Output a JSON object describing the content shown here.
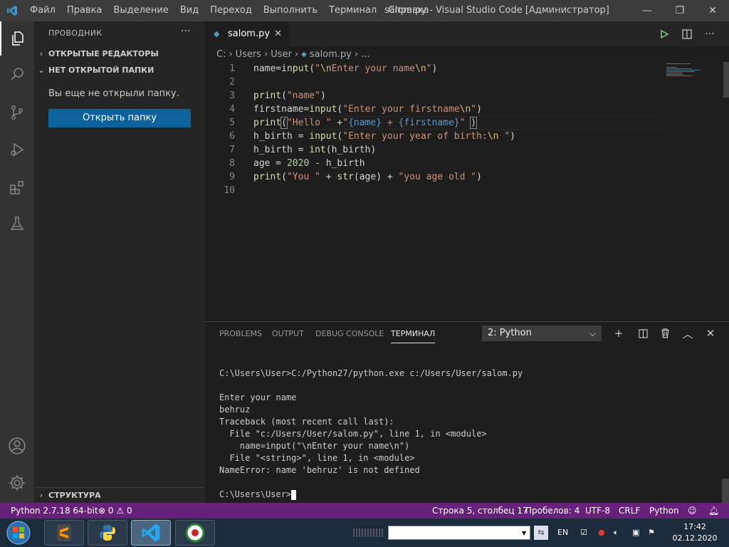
{
  "titlebar": {
    "menu": [
      "Файл",
      "Правка",
      "Выделение",
      "Вид",
      "Переход",
      "Выполнить",
      "Терминал",
      "Справка"
    ],
    "window_title": "salom.py - Visual Studio Code [Администратор]",
    "minimize": "—",
    "maximize": "❐",
    "close": "✕"
  },
  "sidebar": {
    "title": "ПРОВОДНИК",
    "more": "···",
    "sections": {
      "open_editors": "ОТКРЫТЫЕ РЕДАКТОРЫ",
      "no_folder": "НЕТ ОТКРЫТОЙ ПАПКИ",
      "structure": "СТРУКТУРА"
    },
    "no_folder_message": "Вы еще не открыли папку.",
    "open_folder_button": "Открыть папку"
  },
  "editor": {
    "tab": {
      "label": "salom.py",
      "close": "✕"
    },
    "breadcrumb": [
      "C:",
      "Users",
      "User",
      "salom.py",
      "..."
    ],
    "lines": [
      "1",
      "2",
      "3",
      "4",
      "5",
      "6",
      "7",
      "8",
      "9",
      "10"
    ]
  },
  "panel": {
    "tabs": [
      "PROBLEMS",
      "OUTPUT",
      "DEBUG CONSOLE",
      "ТЕРМИНАЛ"
    ],
    "terminal_select": "2: Python",
    "terminal_lines": [
      "C:\\Users\\User>C:/Python27/python.exe c:/Users/User/salom.py",
      "",
      "Enter your name",
      "behruz",
      "Traceback (most recent call last):",
      "  File \"c:/Users/User/salom.py\", line 1, in <module>",
      "    name=input(\"\\nEnter your name\\n\")",
      "  File \"<string>\", line 1, in <module>",
      "NameError: name 'behruz' is not defined",
      ""
    ],
    "prompt": "C:\\Users\\User>"
  },
  "statusbar": {
    "python": "Python 2.7.18 64-bit",
    "errors": "0",
    "warnings": "0",
    "position": "Строка 5, столбец 17",
    "spaces": "Пробелов: 4",
    "encoding": "UTF-8",
    "eol": "CRLF",
    "language": "Python"
  },
  "taskbar": {
    "lang": "EN",
    "time": "17:42",
    "date": "02.12.2020"
  },
  "colors": {
    "statusbar": "#68217a",
    "button": "#0e639c",
    "activity_bar": "#333333",
    "sidebar": "#252526",
    "editor": "#1e1e1e"
  }
}
